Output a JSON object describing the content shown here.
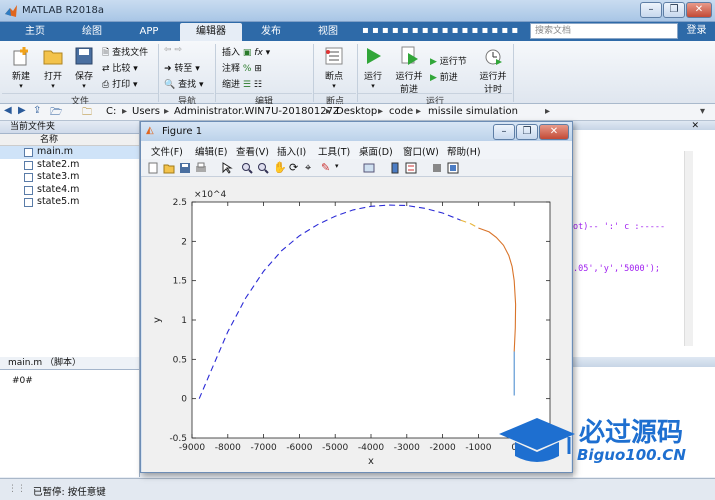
{
  "app": {
    "title": "MATLAB R2018a",
    "window_buttons": [
      "–",
      "❐",
      "✕"
    ]
  },
  "tabs": [
    {
      "label": "主页"
    },
    {
      "label": "绘图"
    },
    {
      "label": "APP"
    },
    {
      "label": "编辑器"
    },
    {
      "label": "发布"
    },
    {
      "label": "视图"
    }
  ],
  "search": {
    "placeholder": "搜索文档"
  },
  "login": "登录",
  "ribbon": {
    "new": "新建",
    "open": "打开",
    "save": "保存",
    "find_files": "查找文件",
    "compare": "比较",
    "print": "打印",
    "goto": "转至",
    "find": "查找",
    "insert": "插入",
    "fx": "fx",
    "comment": "注释",
    "indent": "缩进",
    "breakpoint": "断点",
    "run": "运行",
    "run_advance": "运行并\n前进",
    "run_section": "运行节",
    "advance": "前进",
    "run_time": "运行并\n计时",
    "sections": [
      "文件",
      "导航",
      "编辑",
      "断点",
      "运行"
    ]
  },
  "address": {
    "parts": [
      "C:",
      "Users",
      "Administrator.WIN7U-20180127Z",
      "Desktop",
      "code",
      "missile simulation"
    ]
  },
  "current_folder": {
    "header": "当前文件夹",
    "column": "名称",
    "files": [
      "main.m",
      "state2.m",
      "state3.m",
      "state4.m",
      "state5.m"
    ],
    "selected": "main.m"
  },
  "details": {
    "header": "main.m （脚本）",
    "content": "#0#"
  },
  "editor_fragments": [
    "ot)--   ':'  c :-----",
    ".05','y','5000');"
  ],
  "status": {
    "text": "已暂停: 按任意键"
  },
  "figure": {
    "title": "Figure 1",
    "menu": [
      "文件(F)",
      "编辑(E)",
      "查看(V)",
      "插入(I)",
      "工具(T)",
      "桌面(D)",
      "窗口(W)",
      "帮助(H)"
    ],
    "window_buttons": [
      "–",
      "❐",
      "✕"
    ]
  },
  "watermark": {
    "title": "必过源码",
    "subtitle": "Biguo100.CN"
  },
  "chart_data": {
    "type": "line",
    "xlabel": "x",
    "ylabel": "y",
    "y_multiplier": "×10^4",
    "xlim": [
      -9000,
      1000
    ],
    "ylim": [
      -0.5,
      2.5
    ],
    "x_ticks": [
      -9000,
      -8000,
      -7000,
      -6000,
      -5000,
      -4000,
      -3000,
      -2000,
      -1000,
      0
    ],
    "x_tick_labels": [
      "-9000",
      "-8000",
      "-7000",
      "-6000",
      "-5000",
      "-4000",
      "-3000",
      "-2000",
      "-1000",
      "0"
    ],
    "y_ticks": [
      -0.5,
      0,
      0.5,
      1,
      1.5,
      2,
      2.5
    ],
    "y_tick_labels": [
      "-0.5",
      "0",
      "0.5",
      "1",
      "1.5",
      "2",
      "2.5"
    ],
    "grid": false,
    "series": [
      {
        "style": "dashed",
        "color": "#2b2bd6",
        "x": [
          -8800,
          -8500,
          -8000,
          -7500,
          -7000,
          -6500,
          -6000,
          -5500,
          -5000,
          -4500,
          -4000,
          -3500,
          -3000,
          -2500,
          -2000,
          -1500
        ],
        "y": [
          0.0,
          0.32,
          0.85,
          1.28,
          1.62,
          1.88,
          2.07,
          2.21,
          2.32,
          2.4,
          2.445,
          2.46,
          2.455,
          2.42,
          2.36,
          2.27
        ]
      },
      {
        "style": "dashed",
        "color": "#e8b43a",
        "x": [
          -1500,
          -1200,
          -1000
        ],
        "y": [
          2.27,
          2.22,
          2.17
        ]
      },
      {
        "style": "solid",
        "color": "#d9742a",
        "x": [
          -1000,
          -700,
          -500,
          -300,
          -150,
          -60,
          0,
          40,
          30,
          0
        ],
        "y": [
          2.17,
          2.12,
          2.05,
          1.95,
          1.82,
          1.68,
          1.5,
          1.2,
          0.9,
          0.6
        ]
      },
      {
        "style": "solid",
        "color": "#4f8fd0",
        "x": [
          0,
          0
        ],
        "y": [
          0.6,
          0.04
        ]
      }
    ]
  }
}
